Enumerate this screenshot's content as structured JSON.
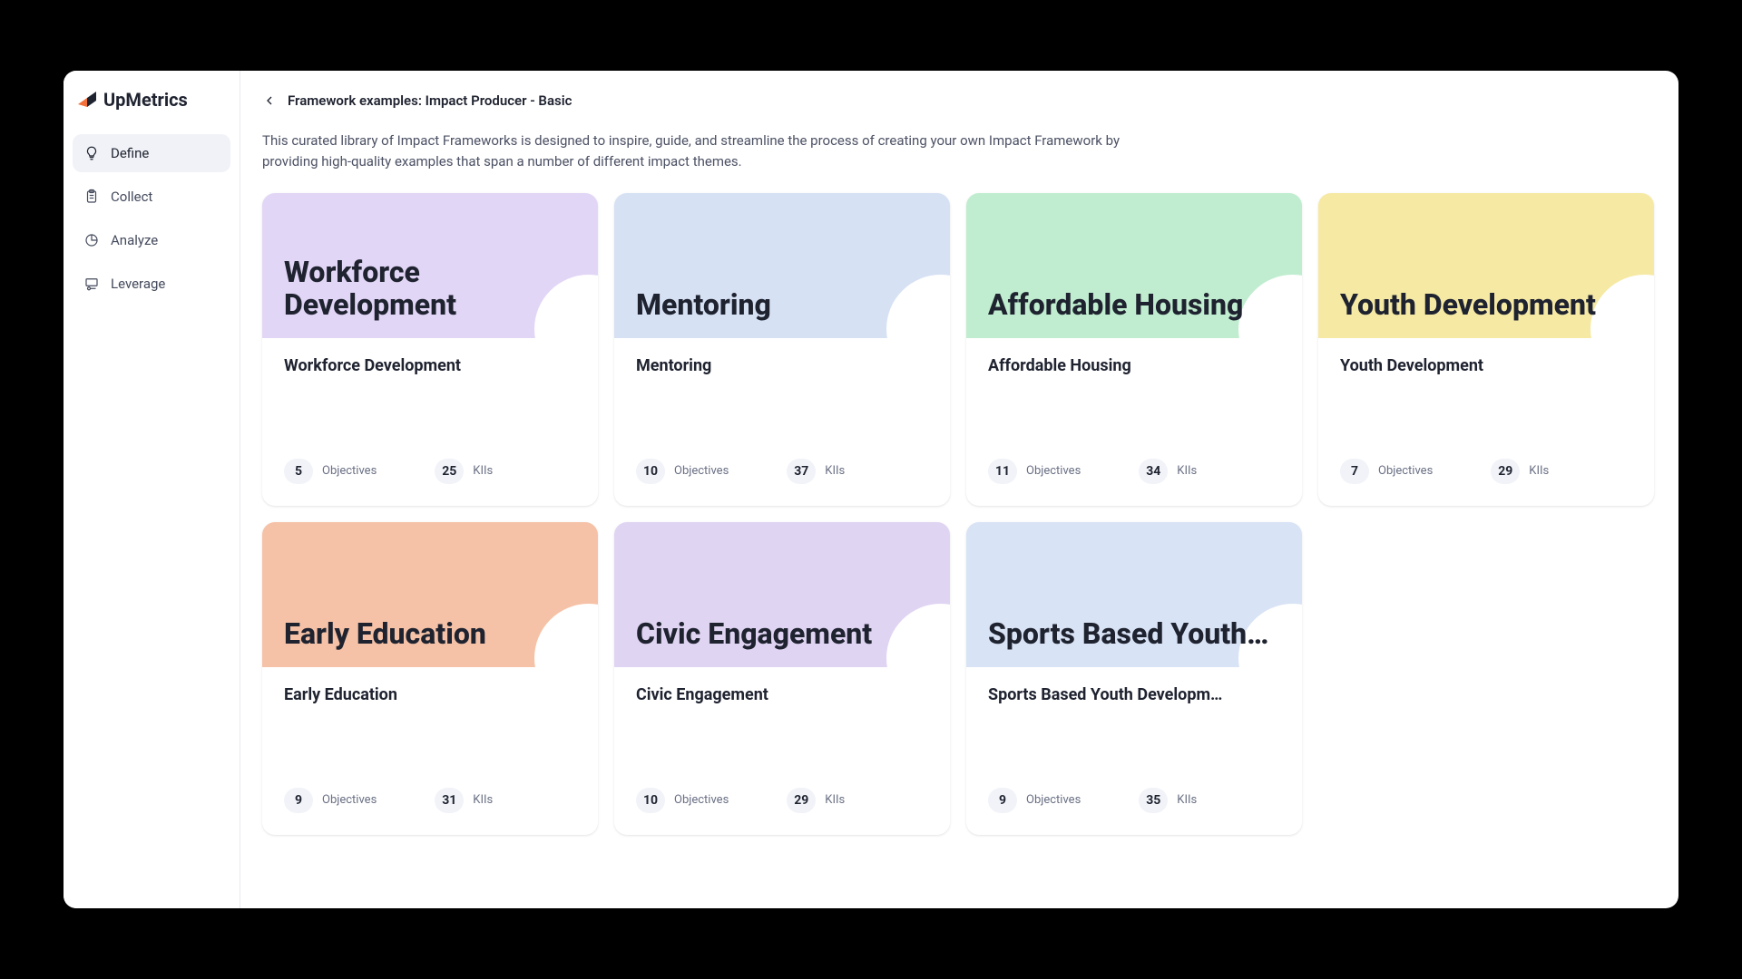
{
  "brand": {
    "name": "UpMetrics"
  },
  "sidebar": {
    "items": [
      {
        "label": "Define",
        "active": true
      },
      {
        "label": "Collect",
        "active": false
      },
      {
        "label": "Analyze",
        "active": false
      },
      {
        "label": "Leverage",
        "active": false
      }
    ]
  },
  "breadcrumb": {
    "text": "Framework examples: Impact Producer - Basic"
  },
  "intro": "This curated library of Impact Frameworks is designed to inspire, guide, and streamline the process of creating your own Impact Framework by providing high-quality examples that span a number of different impact themes.",
  "stat_labels": {
    "objectives": "Objectives",
    "kiis": "KIIs"
  },
  "cards": [
    {
      "title": "Workforce Development",
      "subtitle": "Workforce Development",
      "objectives": 5,
      "kiis": 25,
      "color": "bg-purple"
    },
    {
      "title": "Mentoring",
      "subtitle": "Mentoring",
      "objectives": 10,
      "kiis": 37,
      "color": "bg-blue"
    },
    {
      "title": "Affordable Housing",
      "subtitle": "Affordable Housing",
      "objectives": 11,
      "kiis": 34,
      "color": "bg-green"
    },
    {
      "title": "Youth Development",
      "subtitle": "Youth Development",
      "objectives": 7,
      "kiis": 29,
      "color": "bg-yellow"
    },
    {
      "title": "Early Education",
      "subtitle": "Early Education",
      "objectives": 9,
      "kiis": 31,
      "color": "bg-orange"
    },
    {
      "title": "Civic Engagement",
      "subtitle": "Civic Engagement",
      "objectives": 10,
      "kiis": 29,
      "color": "bg-purple2"
    },
    {
      "title": "Sports Based Youth…",
      "subtitle": "Sports Based Youth Developm…",
      "objectives": 9,
      "kiis": 35,
      "color": "bg-blue2"
    }
  ]
}
